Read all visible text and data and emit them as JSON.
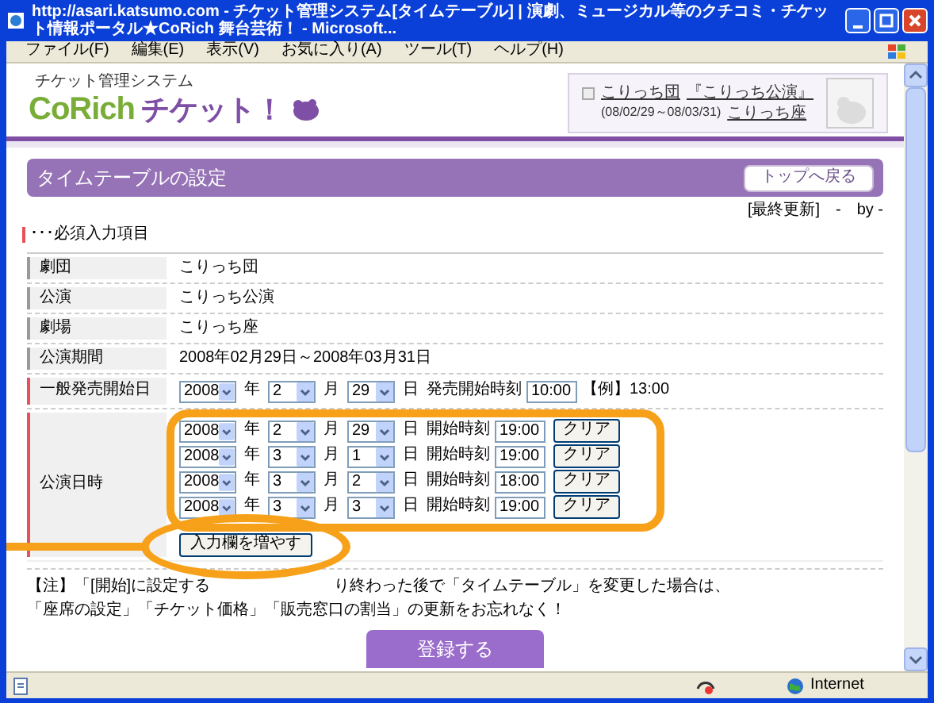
{
  "window": {
    "title": "http://asari.katsumo.com - チケット管理システム[タイムテーブル] | 演劇、ミュージカル等のクチコミ・チケット情報ポータル★CoRich 舞台芸術！ - Microsoft..."
  },
  "menu": [
    "ファイル(F)",
    "編集(E)",
    "表示(V)",
    "お気に入り(A)",
    "ツール(T)",
    "ヘルプ(H)"
  ],
  "header": {
    "system_name": "チケット管理システム",
    "logo_latin": "CoRich",
    "logo_kana": "チケット！"
  },
  "performance_box": {
    "troupe": "こりっち団",
    "title": "『こりっち公演』",
    "period": "(08/02/29～08/03/31)",
    "venue": "こりっち座"
  },
  "page_title": "タイムテーブルの設定",
  "top_button": "トップへ戻る",
  "updated": "[最終更新]　-　by -",
  "required_legend": "･･･必須入力項目",
  "info_rows": [
    {
      "label": "劇団",
      "value": "こりっち団",
      "required": false
    },
    {
      "label": "公演",
      "value": "こりっち公演",
      "required": false
    },
    {
      "label": "劇場",
      "value": "こりっち座",
      "required": false
    },
    {
      "label": "公演期間",
      "value": "2008年02月29日～2008年03月31日",
      "required": false
    }
  ],
  "release": {
    "label": "一般発売開始日",
    "required": true,
    "year": "2008",
    "month": "2",
    "day": "29",
    "units": [
      "年",
      "月",
      "日"
    ],
    "time_label": "発売開始時刻",
    "time": "10:00",
    "example": "【例】13:00"
  },
  "schedule": {
    "label": "公演日時",
    "required": true,
    "rows": [
      {
        "year": "2008",
        "month": "2",
        "day": "29",
        "units": [
          "年",
          "月",
          "日"
        ],
        "time_label": "開始時刻",
        "time": "19:00",
        "clear": "クリア"
      },
      {
        "year": "2008",
        "month": "3",
        "day": "1",
        "units": [
          "年",
          "月",
          "日"
        ],
        "time_label": "開始時刻",
        "time": "19:00",
        "clear": "クリア"
      },
      {
        "year": "2008",
        "month": "3",
        "day": "2",
        "units": [
          "年",
          "月",
          "日"
        ],
        "time_label": "開始時刻",
        "time": "18:00",
        "clear": "クリア"
      },
      {
        "year": "2008",
        "month": "3",
        "day": "3",
        "units": [
          "年",
          "月",
          "日"
        ],
        "time_label": "開始時刻",
        "time": "19:00",
        "clear": "クリア"
      }
    ],
    "add_button": "入力欄を増やす"
  },
  "note": [
    {
      "parts": [
        "【注】「[開始]に設定する",
        "り終わった後で「タイムテーブル」を変更した場合は、"
      ]
    },
    {
      "parts": [
        "「座席の設定」「チケット価格」「販売窓口の割当」の更新をお忘れなく！"
      ]
    }
  ],
  "submit": "登録する",
  "status_bar": {
    "zone": "Internet"
  }
}
